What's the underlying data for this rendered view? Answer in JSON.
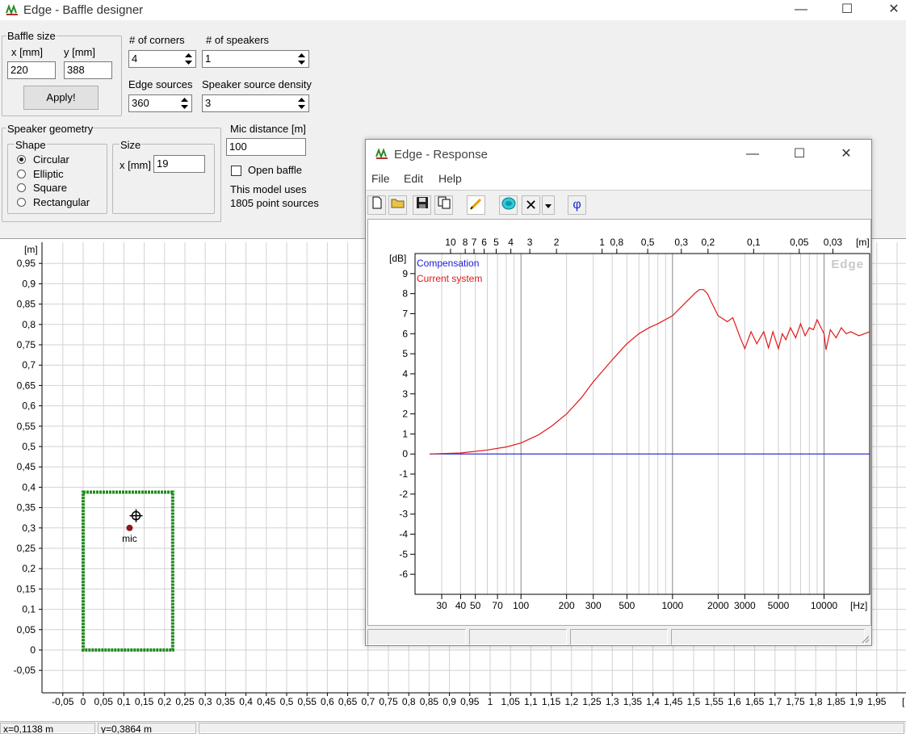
{
  "window": {
    "title": "Edge - Baffle designer",
    "minimize": "—",
    "maximize": "☐",
    "close": "✕"
  },
  "baffle": {
    "group_label": "Baffle size",
    "x_label": "x [mm]",
    "y_label": "y [mm]",
    "x_value": "220",
    "y_value": "388",
    "apply_label": "Apply!"
  },
  "corners": {
    "label": "# of corners",
    "value": "4"
  },
  "speakers": {
    "label": "# of speakers",
    "value": "1"
  },
  "edge_sources": {
    "label": "Edge sources",
    "value": "360"
  },
  "speaker_density": {
    "label": "Speaker source density",
    "value": "3"
  },
  "geometry": {
    "group_label": "Speaker geometry",
    "shape_label": "Shape",
    "shapes": [
      "Circular",
      "Elliptic",
      "Square",
      "Rectangular"
    ],
    "selected_shape": "Circular",
    "size_label": "Size",
    "size_x_label": "x [mm]",
    "size_x_value": "19"
  },
  "mic": {
    "label": "Mic distance [m]",
    "value": "100",
    "open_baffle_label": "Open baffle",
    "open_baffle_checked": false,
    "model_info_line1": "This model uses",
    "model_info_line2": "1805 point sources",
    "marker_label": "mic"
  },
  "baffle_plot": {
    "y_unit": "[m]",
    "y_ticks": [
      "0,95",
      "0,9",
      "0,85",
      "0,8",
      "0,75",
      "0,7",
      "0,65",
      "0,6",
      "0,55",
      "0,5",
      "0,45",
      "0,4",
      "0,35",
      "0,3",
      "0,25",
      "0,2",
      "0,15",
      "0,1",
      "0,05",
      "0",
      "-0,05"
    ],
    "x_ticks": [
      "-0,05",
      "0",
      "0,05",
      "0,1",
      "0,15",
      "0,2",
      "0,25",
      "0,3",
      "0,35",
      "0,4",
      "0,45",
      "0,5",
      "0,55",
      "0,6",
      "0,65",
      "0,7",
      "0,75",
      "0,8",
      "0,85",
      "0,9",
      "0,95",
      "1",
      "1,05",
      "1,1",
      "1,15",
      "1,2",
      "1,25",
      "1,3",
      "1,35",
      "1,4",
      "1,45",
      "1,5",
      "1,55",
      "1,6",
      "1,65",
      "1,7",
      "1,75",
      "1,8",
      "1,85",
      "1,9",
      "1,95"
    ],
    "x_unit": "[",
    "baffle_color": "#1f8a1f",
    "mic_color": "#8b1a1a"
  },
  "statusbar": {
    "x_readout": "x=0,1138 m",
    "y_readout": "y=0,3864 m"
  },
  "response": {
    "title": "Edge - Response",
    "menu": [
      "File",
      "Edit",
      "Help"
    ],
    "toolbar_icons": [
      "new-icon",
      "open-folder-icon",
      "save-icon",
      "copy-icon",
      "pen-icon",
      "speaker-icon",
      "delete-icon",
      "dropdown-icon",
      "phase-icon"
    ],
    "phase_symbol": "φ",
    "delete_symbol": "✕",
    "watermark": "Edge",
    "chart_data": {
      "type": "line",
      "xscale": "log",
      "xlim": [
        20,
        20000
      ],
      "ylim": [
        -7,
        10
      ],
      "xlabel_unit": "[Hz]",
      "ylabel_unit": "[dB]",
      "x_tick_labels": [
        "30",
        "40",
        "50",
        "70",
        "100",
        "200",
        "300",
        "500",
        "1000",
        "2000",
        "3000",
        "5000",
        "10000"
      ],
      "x_tick_values": [
        30,
        40,
        50,
        70,
        100,
        200,
        300,
        500,
        1000,
        2000,
        3000,
        5000,
        10000
      ],
      "y_ticks": [
        9,
        8,
        7,
        6,
        5,
        4,
        3,
        2,
        1,
        0,
        -1,
        -2,
        -3,
        -4,
        -5,
        -6
      ],
      "top_axis_unit": "[m]",
      "top_tick_labels": [
        "10",
        "8",
        "7",
        "6",
        "5",
        "4",
        "3",
        "2",
        "1",
        "0,8",
        "0,5",
        "0,3",
        "0,2",
        "0,1",
        "0,05",
        "0,03"
      ],
      "top_tick_values": [
        10,
        8,
        7,
        6,
        5,
        4,
        3,
        2,
        1,
        0.8,
        0.5,
        0.3,
        0.2,
        0.1,
        0.05,
        0.03
      ],
      "grid": true,
      "legend_position": "top-left",
      "series": [
        {
          "name": "Compensation",
          "color": "#1a1ad6",
          "x": [
            25,
            20000
          ],
          "y": [
            0,
            0
          ]
        },
        {
          "name": "Current system",
          "color": "#e01818",
          "x": [
            25,
            40,
            60,
            80,
            100,
            130,
            160,
            200,
            250,
            300,
            400,
            500,
            600,
            700,
            800,
            1000,
            1200,
            1400,
            1500,
            1600,
            1700,
            1800,
            2000,
            2300,
            2500,
            2800,
            3000,
            3300,
            3600,
            4000,
            4300,
            4600,
            5000,
            5300,
            5600,
            6000,
            6500,
            7000,
            7500,
            8000,
            8500,
            9000,
            10000,
            10300,
            11000,
            12000,
            13000,
            14000,
            15000,
            17000,
            20000
          ],
          "y": [
            0.0,
            0.05,
            0.2,
            0.35,
            0.55,
            0.95,
            1.4,
            2.0,
            2.8,
            3.6,
            4.7,
            5.5,
            6.0,
            6.3,
            6.5,
            6.9,
            7.5,
            8.0,
            8.2,
            8.2,
            8.0,
            7.6,
            6.9,
            6.6,
            6.8,
            5.8,
            5.25,
            6.1,
            5.5,
            6.1,
            5.3,
            6.1,
            5.25,
            6.0,
            5.7,
            6.3,
            5.8,
            6.5,
            5.9,
            6.3,
            6.2,
            6.7,
            6.0,
            5.2,
            6.2,
            5.8,
            6.3,
            6.0,
            6.1,
            5.9,
            6.1
          ]
        }
      ]
    }
  }
}
